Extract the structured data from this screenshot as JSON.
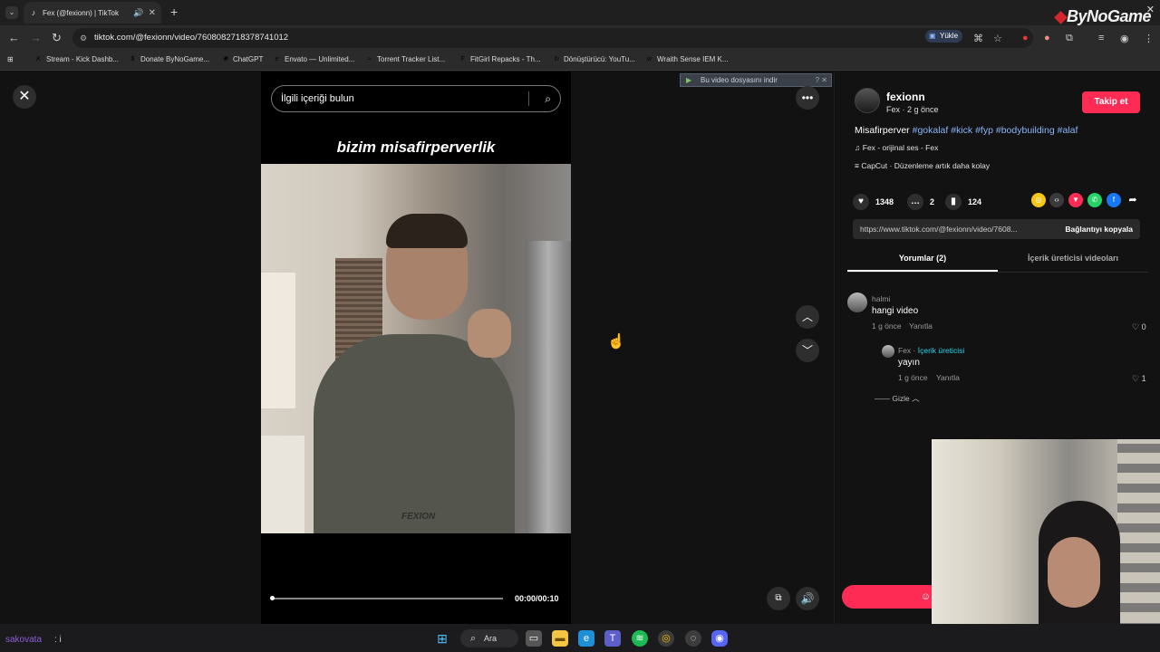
{
  "browser": {
    "tab_title": "Fex (@fexionn) | TikTok",
    "url": "tiktok.com/@fexionn/video/7608082718378741012",
    "install_label": "Yükle",
    "brand": "ByNoGame",
    "bookmarks": [
      {
        "label": "Stream - Kick Dashb...",
        "color": "#53fc18"
      },
      {
        "label": "Donate ByNoGame...",
        "color": "#f5a623"
      },
      {
        "label": "ChatGPT",
        "color": "#d9d9d9"
      },
      {
        "label": "Envato — Unlimited...",
        "color": "#82b541"
      },
      {
        "label": "Torrent Tracker List...",
        "color": "#888888"
      },
      {
        "label": "FitGirl Repacks - Th...",
        "color": "#c0392b"
      },
      {
        "label": "Dönüştürücü: YouTu...",
        "color": "#e74c3c"
      },
      {
        "label": "Wraith Sense IEM K...",
        "color": "#bbbbbb"
      }
    ]
  },
  "video": {
    "search_placeholder": "İlgili içeriği bulun",
    "overlay_text": "bizim misafirperverlik",
    "watermark": "FEXION",
    "time": "00:00/00:10",
    "progress": 0.0,
    "download_banner": "Bu video dosyasını indir"
  },
  "author": {
    "username": "fexionn",
    "subline": "Fex · 2 g önce",
    "follow_label": "Takip et",
    "caption_prefix": "Misafirperver",
    "hashtags": [
      "#gokalaf",
      "#kick",
      "#fyp",
      "#bodybuilding",
      "#alaf"
    ],
    "sound": "Fex - orijinal ses - Fex",
    "capcut": "CapCut · Düzenleme artık daha kolay"
  },
  "stats": {
    "likes": "1348",
    "comments": "2",
    "saves": "124"
  },
  "share": {
    "link": "https://www.tiktok.com/@fexionn/video/7608...",
    "copy_label": "Bağlantıyı kopyala",
    "icon_colors": [
      "#f5c518",
      "#3a3a3a",
      "#fe2c55",
      "#25d366",
      "#1877f2"
    ]
  },
  "tabs": {
    "comments": "Yorumlar (2)",
    "creator_videos": "İçerik üreticisi videoları"
  },
  "comments": [
    {
      "user": "halmi",
      "text": "hangi video",
      "time": "1 g önce",
      "reply": "Yanıtla",
      "likes": "0"
    },
    {
      "user": "Fex",
      "badge": "İçerik üreticisi",
      "text": "yayın",
      "time": "1 g önce",
      "reply": "Yanıtla",
      "likes": "1"
    }
  ],
  "hide_label": "Gizle",
  "taskbar": {
    "chat_user": "sakovata",
    "chat_msg": ": i",
    "search_label": "Ara"
  }
}
